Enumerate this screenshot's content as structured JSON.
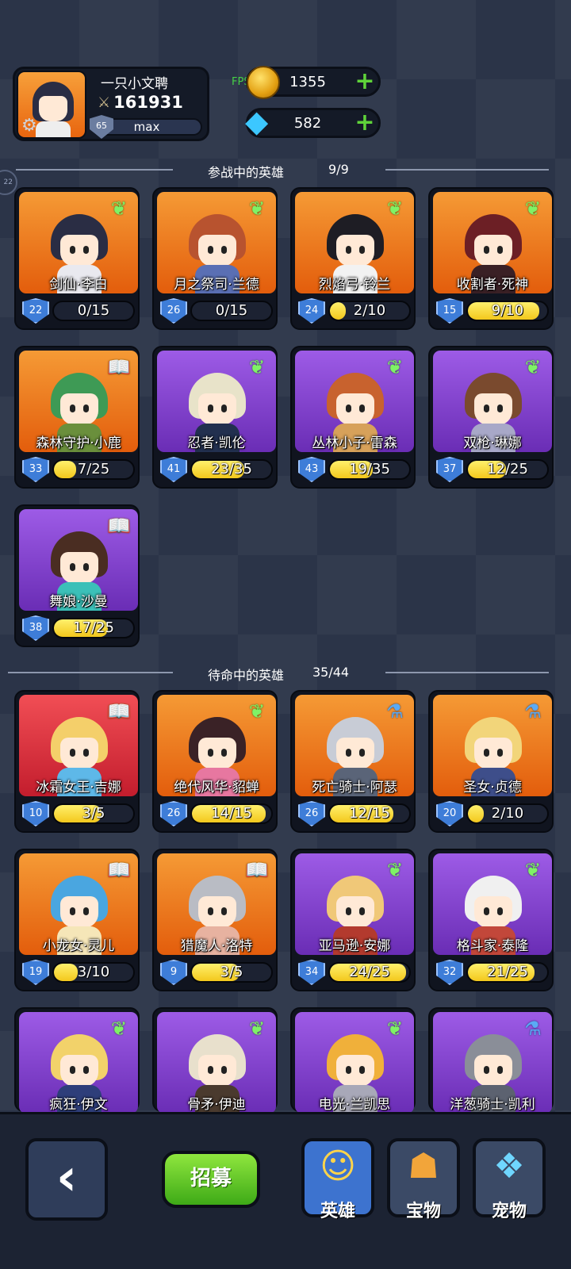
{
  "header": {
    "player_name": "一只小文聘",
    "power": "161931",
    "level": "65",
    "level_status": "max",
    "fps": "FPS:52",
    "gold": "1355",
    "gems": "582"
  },
  "edge_badge": "22",
  "active_section": {
    "title": "参战中的英雄",
    "count": "9/9"
  },
  "standby_section": {
    "title": "待命中的英雄",
    "count": "35/44"
  },
  "active_heroes": [
    {
      "name": "剑仙·李白",
      "level": "22",
      "progress": "0/15",
      "frac": 0,
      "bg": "orange",
      "badge": "leaf",
      "hair": "#2a2d44",
      "body": "#e9e9ef"
    },
    {
      "name": "月之祭司·兰德",
      "level": "26",
      "progress": "0/15",
      "frac": 0,
      "bg": "orange",
      "badge": "leaf",
      "hair": "#b8532f",
      "body": "#5a6fb4"
    },
    {
      "name": "烈焰弓·铃兰",
      "level": "24",
      "progress": "2/10",
      "frac": 0.2,
      "bg": "orange",
      "badge": "leaf",
      "hair": "#1e1d24",
      "body": "#f2f2f2"
    },
    {
      "name": "收割者·死神",
      "level": "15",
      "progress": "9/10",
      "frac": 0.9,
      "bg": "orange",
      "badge": "leaf",
      "hair": "#6c1f25",
      "body": "#3a2025"
    },
    {
      "name": "森林守护·小鹿",
      "level": "33",
      "progress": "7/25",
      "frac": 0.28,
      "bg": "orange",
      "badge": "book",
      "hair": "#3e9a55",
      "body": "#6a8f3c"
    },
    {
      "name": "忍者·凯伦",
      "level": "41",
      "progress": "23/35",
      "frac": 0.66,
      "bg": "purple",
      "badge": "leaf",
      "hair": "#e8e3c9",
      "body": "#22304f"
    },
    {
      "name": "丛林小子·雷森",
      "level": "43",
      "progress": "19/35",
      "frac": 0.54,
      "bg": "purple",
      "badge": "leaf",
      "hair": "#c8622e",
      "body": "#d7a15a"
    },
    {
      "name": "双枪·琳娜",
      "level": "37",
      "progress": "12/25",
      "frac": 0.48,
      "bg": "purple",
      "badge": "leaf",
      "hair": "#7a4a2e",
      "body": "#a8a8c8"
    },
    {
      "name": "舞娘·沙曼",
      "level": "38",
      "progress": "17/25",
      "frac": 0.68,
      "bg": "purple",
      "badge": "book",
      "hair": "#4a2d22",
      "body": "#3bc0b8"
    }
  ],
  "standby_heroes": [
    {
      "name": "冰霜女王·吉娜",
      "level": "10",
      "progress": "3/5",
      "frac": 0.6,
      "bg": "red",
      "badge": "book",
      "hair": "#f4cf6a",
      "body": "#5eb8e8"
    },
    {
      "name": "绝代风华·貂蝉",
      "level": "26",
      "progress": "14/15",
      "frac": 0.93,
      "bg": "orange",
      "badge": "leaf",
      "hair": "#3a2226",
      "body": "#e777a0"
    },
    {
      "name": "死亡骑士·阿瑟",
      "level": "26",
      "progress": "12/15",
      "frac": 0.8,
      "bg": "orange",
      "badge": "potion",
      "hair": "#c8ccd6",
      "body": "#5a6478"
    },
    {
      "name": "圣女·贞德",
      "level": "20",
      "progress": "2/10",
      "frac": 0.2,
      "bg": "orange",
      "badge": "potion",
      "hair": "#f2d57a",
      "body": "#3e4e8a"
    },
    {
      "name": "小龙女·灵儿",
      "level": "19",
      "progress": "3/10",
      "frac": 0.3,
      "bg": "orange",
      "badge": "book",
      "hair": "#4aa6e0",
      "body": "#f5e6b8"
    },
    {
      "name": "猎魔人·洛特",
      "level": "9",
      "progress": "3/5",
      "frac": 0.6,
      "bg": "orange",
      "badge": "book",
      "hair": "#b9bcc4",
      "body": "#e7b2a0"
    },
    {
      "name": "亚马逊·安娜",
      "level": "34",
      "progress": "24/25",
      "frac": 0.96,
      "bg": "purple",
      "badge": "leaf",
      "hair": "#f0c878",
      "body": "#b33a2e"
    },
    {
      "name": "格斗家·泰隆",
      "level": "32",
      "progress": "21/25",
      "frac": 0.84,
      "bg": "purple",
      "badge": "leaf",
      "hair": "#f0f0f0",
      "body": "#c2473a"
    },
    {
      "name": "疯狂·伊文",
      "level": "",
      "progress": "",
      "frac": 0,
      "bg": "purple",
      "badge": "leaf",
      "hair": "#f2d26a",
      "body": "#2e3e7a"
    },
    {
      "name": "骨矛·伊迪",
      "level": "",
      "progress": "",
      "frac": 0,
      "bg": "purple",
      "badge": "leaf",
      "hair": "#e8e0cc",
      "body": "#4a3a2e"
    },
    {
      "name": "电光·兰凯思",
      "level": "",
      "progress": "",
      "frac": 0,
      "bg": "purple",
      "badge": "leaf",
      "hair": "#f0b03a",
      "body": "#a8a8b8"
    },
    {
      "name": "洋葱骑士·凯利",
      "level": "",
      "progress": "",
      "frac": 0,
      "bg": "purple",
      "badge": "potion",
      "hair": "#8a8e98",
      "body": "#5c6270"
    }
  ],
  "bottom_nav": {
    "back_icon": "chevron-left-icon",
    "recruit_label": "招募",
    "tabs": [
      {
        "label": "英雄",
        "icon": "hero-icon",
        "active": true
      },
      {
        "label": "宝物",
        "icon": "treasure-icon",
        "active": false
      },
      {
        "label": "宠物",
        "icon": "pet-icon",
        "active": false
      }
    ]
  }
}
